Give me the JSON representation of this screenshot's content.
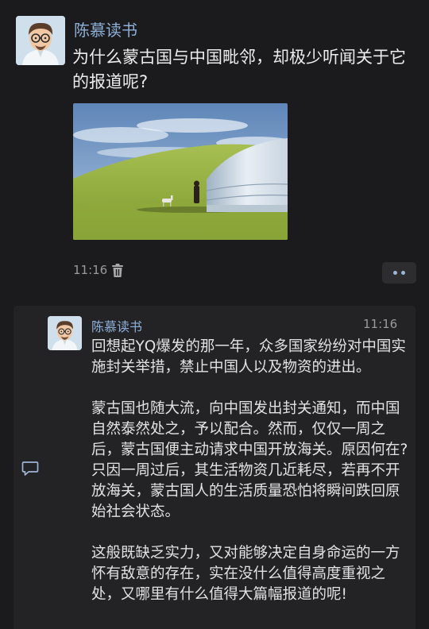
{
  "post": {
    "author": "陈慕读书",
    "text": "为什么蒙古国与中国毗邻，却极少听闻关于它的报道呢?",
    "time": "11:16"
  },
  "comment": {
    "author": "陈慕读书",
    "time": "11:16",
    "paragraphs": [
      "回想起YQ爆发的那一年，众多国家纷纷对中国实施封关举措，禁止中国人以及物资的进出。",
      "蒙古国也随大流，向中国发出封关通知，而中国自然泰然处之，予以配合。然而，仅仅一周之后，蒙古国便主动请求中国开放海关。原因何在?只因一周过后，其生活物资几近耗尽，若再不开放海关，蒙古国人的生活质量恐怕将瞬间跌回原始社会状态。",
      "这般既缺乏实力，又对能够决定自身命运的一方怀有敌意的存在，实在没什么值得高度重视之处，又哪里有什么值得大篇幅报道的呢!"
    ]
  },
  "colors": {
    "background": "#1b1b1d",
    "panel": "#232325",
    "name_link": "#8fb0d8",
    "text": "#e6e6e6",
    "muted": "#9a9a9a"
  },
  "icons": [
    "avatar",
    "delete-icon",
    "more-dots-icon",
    "comment-icon"
  ]
}
